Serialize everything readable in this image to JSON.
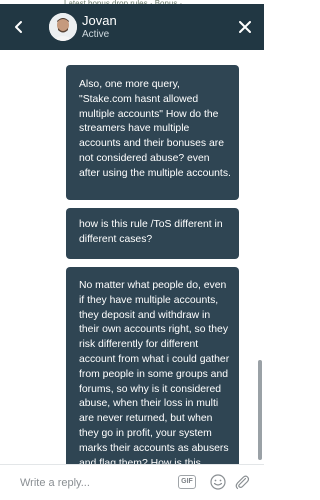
{
  "underlay": {
    "text": "Latest bonus drop rules · Bonus ·"
  },
  "header": {
    "name": "Jovan",
    "status": "Active",
    "back_icon": "chevron-left-icon",
    "close_icon": "close-icon"
  },
  "messages": [
    {
      "text": "Also, one more query, \"Stake.com hasnt allowed multiple accounts\" How do the streamers have multiple accounts and their bonuses are not considered abuse? even after using the multiple accounts."
    },
    {
      "text": "how is this rule /ToS different in different cases?"
    },
    {
      "text": "No matter what people do, even if they have multiple accounts, they deposit and withdraw in their own accounts right, so they risk differently for different account from what i could gather from people in some groups and forums, so why is it considered abuse, when their loss in multi are never returned, but when they go in profit, your system marks their accounts as abusers and flag them? How is this possible?"
    }
  ],
  "composer": {
    "placeholder": "Write a reply...",
    "gif_label": "GIF",
    "emoji_icon": "smiley-icon",
    "attach_icon": "paperclip-icon"
  },
  "colors": {
    "header_bg": "#213743",
    "bubble_bg": "#2f4553",
    "text_light": "#ffffff"
  }
}
